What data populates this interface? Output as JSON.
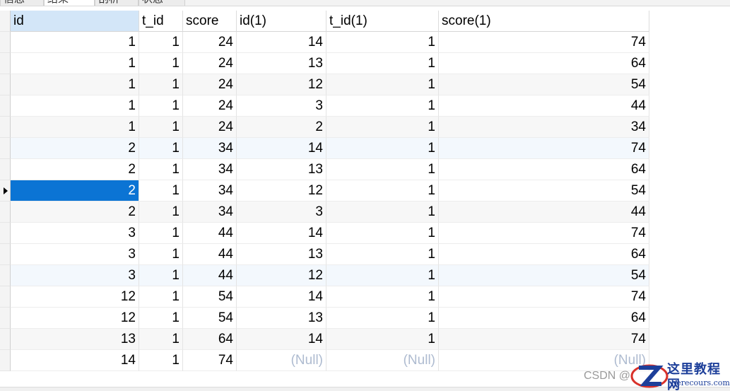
{
  "tabs": [
    {
      "label": "信息",
      "active": false
    },
    {
      "label": "结果",
      "active": true
    },
    {
      "label": "剖析",
      "active": false
    },
    {
      "label": "状态",
      "active": false
    }
  ],
  "table": {
    "columns": [
      "id",
      "t_id",
      "score",
      "id(1)",
      "t_id(1)",
      "score(1)"
    ],
    "rows": [
      [
        "1",
        "1",
        "24",
        "14",
        "1",
        "74"
      ],
      [
        "1",
        "1",
        "24",
        "13",
        "1",
        "64"
      ],
      [
        "1",
        "1",
        "24",
        "12",
        "1",
        "54"
      ],
      [
        "1",
        "1",
        "24",
        "3",
        "1",
        "44"
      ],
      [
        "1",
        "1",
        "24",
        "2",
        "1",
        "34"
      ],
      [
        "2",
        "1",
        "34",
        "14",
        "1",
        "74"
      ],
      [
        "2",
        "1",
        "34",
        "13",
        "1",
        "64"
      ],
      [
        "2",
        "1",
        "34",
        "12",
        "1",
        "54"
      ],
      [
        "2",
        "1",
        "34",
        "3",
        "1",
        "44"
      ],
      [
        "3",
        "1",
        "44",
        "14",
        "1",
        "74"
      ],
      [
        "3",
        "1",
        "44",
        "13",
        "1",
        "64"
      ],
      [
        "3",
        "1",
        "44",
        "12",
        "1",
        "54"
      ],
      [
        "12",
        "1",
        "54",
        "14",
        "1",
        "74"
      ],
      [
        "12",
        "1",
        "54",
        "13",
        "1",
        "64"
      ],
      [
        "13",
        "1",
        "64",
        "14",
        "1",
        "74"
      ],
      [
        "14",
        "1",
        "74",
        "(Null)",
        "(Null)",
        "(Null)"
      ]
    ],
    "selected_row": 7,
    "selected_col": 0
  },
  "watermark": {
    "csdn": "CSDN @",
    "site_name": "这里教程网",
    "site_url": "herecours.com"
  },
  "colors": {
    "selection": "#0b74d4",
    "header_sorted": "#d3e6f8",
    "null_text": "#aebbd0",
    "watermark_blue": "#1d3f9a",
    "watermark_red": "#d8312a"
  }
}
